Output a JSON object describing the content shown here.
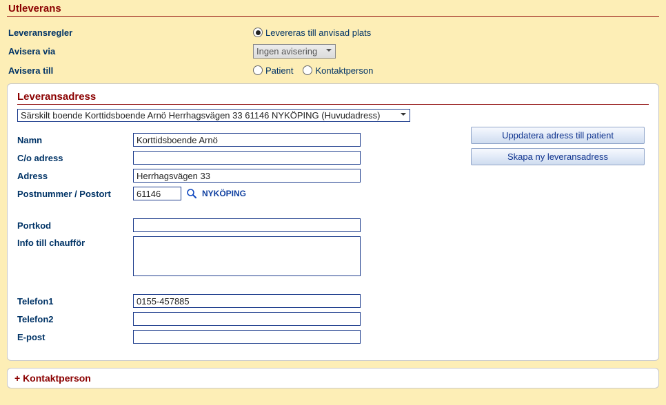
{
  "section_title": "Utleverans",
  "rows": {
    "leveransregler": {
      "label": "Leveransregler",
      "opt1": "Levereras till anvisad plats"
    },
    "avisera_via": {
      "label": "Avisera via",
      "select_value": "Ingen avisering"
    },
    "avisera_till": {
      "label": "Avisera till",
      "opt1": "Patient",
      "opt2": "Kontaktperson"
    }
  },
  "panel": {
    "title": "Leveransadress",
    "address_select": "Särskilt boende Korttidsboende Arnö Herrhagsvägen 33 61146 NYKÖPING (Huvudadress)",
    "buttons": {
      "update": "Uppdatera adress till patient",
      "create": "Skapa ny leveransadress"
    },
    "fields": {
      "namn": {
        "label": "Namn",
        "value": "Korttidsboende Arnö"
      },
      "co": {
        "label": "C/o adress",
        "value": ""
      },
      "adress": {
        "label": "Adress",
        "value": "Herrhagsvägen 33"
      },
      "post": {
        "label": "Postnummer / Postort",
        "value": "61146",
        "city": "NYKÖPING"
      },
      "portkod": {
        "label": "Portkod",
        "value": ""
      },
      "info": {
        "label": "Info till chaufför",
        "value": ""
      },
      "tel1": {
        "label": "Telefon1",
        "value": "0155-457885"
      },
      "tel2": {
        "label": "Telefon2",
        "value": ""
      },
      "epost": {
        "label": "E-post",
        "value": ""
      }
    }
  },
  "kontakt_title": "+ Kontaktperson"
}
